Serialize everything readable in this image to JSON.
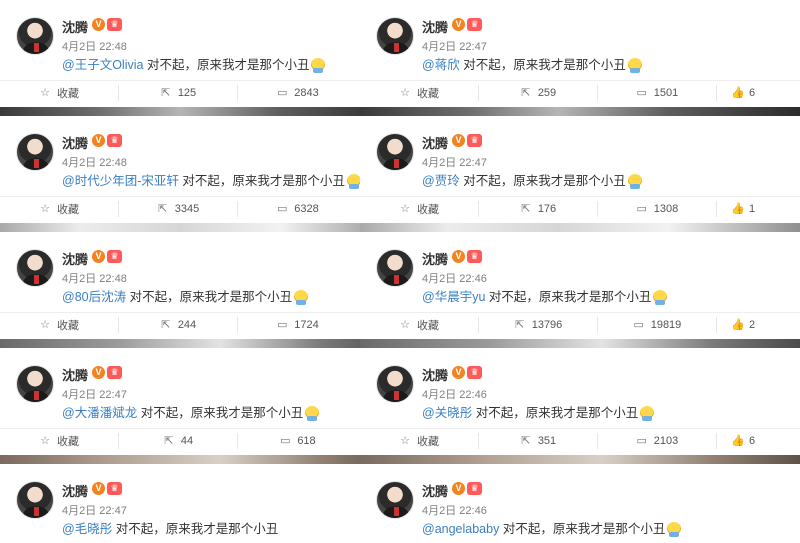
{
  "left_column": [
    {
      "author": "沈腾",
      "date": "4月2日 22:48",
      "mention": "@王子文Olivia",
      "content": "对不起，原来我才是那个小丑",
      "has_emoji": true,
      "favorite_label": "收藏",
      "repost_count": "125",
      "comment_count": "2843"
    },
    {
      "author": "沈腾",
      "date": "4月2日 22:48",
      "mention": "@时代少年团-宋亚轩",
      "content": "对不起，原来我才是那个小丑",
      "has_emoji": true,
      "favorite_label": "收藏",
      "repost_count": "3345",
      "comment_count": "6328"
    },
    {
      "author": "沈腾",
      "date": "4月2日 22:48",
      "mention": "@80后沈涛",
      "content": "对不起，原来我才是那个小丑",
      "has_emoji": true,
      "favorite_label": "收藏",
      "repost_count": "244",
      "comment_count": "1724"
    },
    {
      "author": "沈腾",
      "date": "4月2日 22:47",
      "mention": "@大潘潘斌龙",
      "content": "对不起，原来我才是那个小丑",
      "has_emoji": true,
      "favorite_label": "收藏",
      "repost_count": "44",
      "comment_count": "618"
    },
    {
      "author": "沈腾",
      "date": "4月2日 22:47",
      "mention": "@毛晓彤",
      "content": "对不起，原来我才是那个小丑",
      "has_emoji": false
    }
  ],
  "right_column": [
    {
      "author": "沈腾",
      "date": "4月2日 22:47",
      "mention": "@蒋欣",
      "content": "对不起，原来我才是那个小丑",
      "has_emoji": true,
      "favorite_label": "收藏",
      "repost_count": "259",
      "comment_count": "1501",
      "extra": "6"
    },
    {
      "author": "沈腾",
      "date": "4月2日 22:47",
      "mention": "@贾玲",
      "content": "对不起，原来我才是那个小丑",
      "has_emoji": true,
      "favorite_label": "收藏",
      "repost_count": "176",
      "comment_count": "1308",
      "extra": "1"
    },
    {
      "author": "沈腾",
      "date": "4月2日 22:46",
      "mention": "@华晨宇yu",
      "content": "对不起，原来我才是那个小丑",
      "has_emoji": true,
      "favorite_label": "收藏",
      "repost_count": "13796",
      "comment_count": "19819",
      "extra": "2"
    },
    {
      "author": "沈腾",
      "date": "4月2日 22:46",
      "mention": "@关晓彤",
      "content": "对不起，原来我才是那个小丑",
      "has_emoji": true,
      "favorite_label": "收藏",
      "repost_count": "351",
      "comment_count": "2103",
      "extra": "6"
    },
    {
      "author": "沈腾",
      "date": "4月2日 22:46",
      "mention": "@angelababy",
      "content": "对不起，原来我才是那个小丑",
      "has_emoji": true
    }
  ],
  "icons": {
    "favorite": "star-icon",
    "repost": "repost-icon",
    "comment": "comment-icon",
    "like": "thumb-up-icon",
    "verified": "verified-v-icon",
    "membership": "crown-badge-icon"
  },
  "colors": {
    "mention": "#3a7fc3",
    "verified": "#f58220",
    "badge": "#ff5a5a",
    "text": "#333333",
    "meta": "#808080"
  }
}
